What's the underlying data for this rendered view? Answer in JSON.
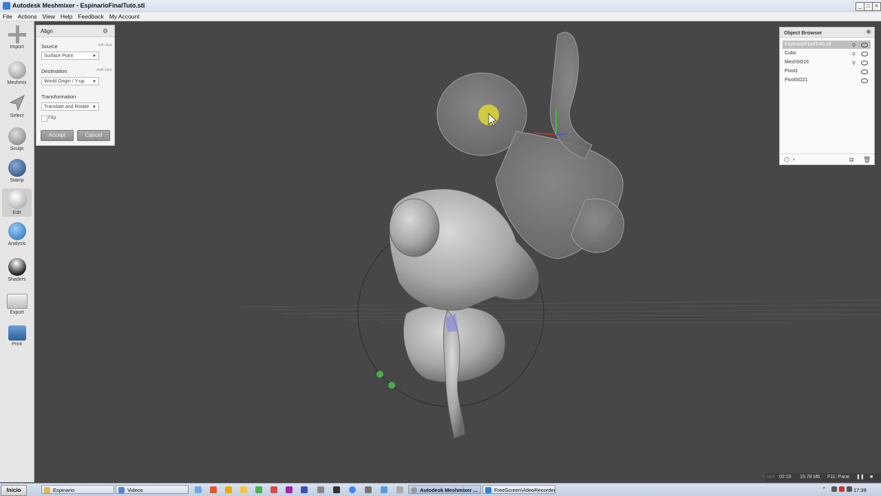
{
  "window": {
    "title": "Autodesk Meshmixer - EspinarioFinalTuto.stl"
  },
  "menu": [
    "File",
    "Actions",
    "View",
    "Help",
    "Feedback",
    "My Account"
  ],
  "toolbar": {
    "items": [
      {
        "label": "Import",
        "icon": "plus-icon"
      },
      {
        "label": "Meshmix",
        "icon": "meshmix-icon"
      },
      {
        "label": "Select",
        "icon": "select-arrow-icon"
      },
      {
        "label": "Sculpt",
        "icon": "sculpt-brush-icon"
      },
      {
        "label": "Stamp",
        "icon": "stamp-icon"
      },
      {
        "label": "Edit",
        "icon": "edit-sphere-icon"
      },
      {
        "label": "Analysis",
        "icon": "analysis-globe-icon"
      },
      {
        "label": "Shaders",
        "icon": "shader-sphere-icon"
      },
      {
        "label": "Export",
        "icon": "export-folder-icon"
      },
      {
        "label": "Print",
        "icon": "printer-icon"
      }
    ]
  },
  "align_panel": {
    "title": "Align",
    "source_label": "Source",
    "source_hint": "left-click",
    "source_value": "Surface Point",
    "destination_label": "Destination",
    "destination_hint": "shift-click",
    "destination_value": "World Origin / Y-up",
    "transformation_label": "Transformation",
    "transformation_value": "Translate and Rotate",
    "flip_label": "Flip",
    "accept_label": "Accept",
    "cancel_label": "Cancel"
  },
  "object_browser": {
    "title": "Object Browser",
    "items": [
      {
        "name": "EspinarioFinalTuto.stl",
        "selected": true
      },
      {
        "name": "Cubo",
        "selected": false
      },
      {
        "name": "MeshSO16",
        "selected": false
      },
      {
        "name": "Pivot1",
        "selected": false
      },
      {
        "name": "PivotSO21",
        "selected": false
      }
    ]
  },
  "status": {
    "prefix": "vert",
    "time": "02:19",
    "memory": "15.78 Mb",
    "hint": "F11: Parar"
  },
  "taskbar": {
    "start_label": "Inicio",
    "tasks": [
      {
        "label": "Espinario",
        "active": false
      },
      {
        "label": "Videos",
        "active": false
      },
      {
        "label": "Autodesk Meshmixer ...",
        "active": true
      },
      {
        "label": "FreeScreenVideoRecorder",
        "active": false
      }
    ],
    "clock": "17:38"
  },
  "colors": {
    "accent": "#3a7bd5",
    "viewport_bg": "#474747",
    "selected_row": "#bfbfbf"
  }
}
